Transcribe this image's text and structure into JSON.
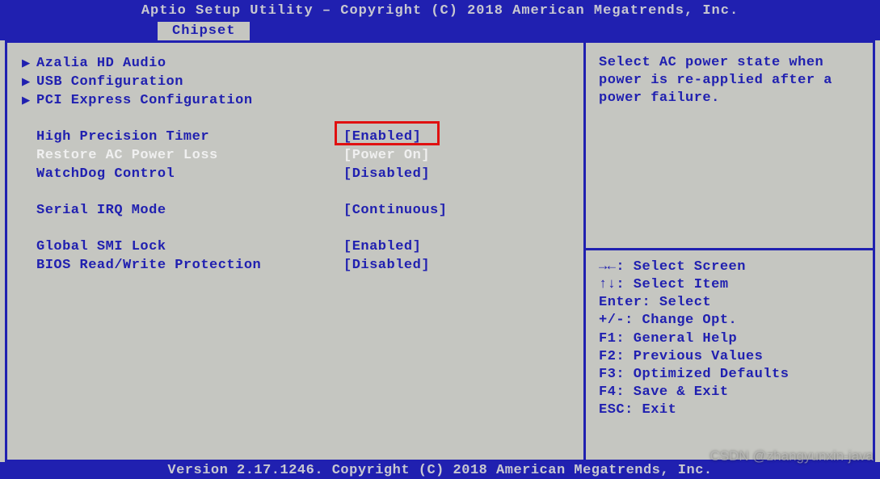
{
  "title": "Aptio Setup Utility – Copyright (C) 2018 American Megatrends, Inc.",
  "tab": "Chipset",
  "submenus": [
    "Azalia HD Audio",
    "USB Configuration",
    "PCI Express Configuration"
  ],
  "settings": {
    "group1": [
      {
        "label": "High Precision Timer",
        "value": "[Enabled]",
        "selected": false
      },
      {
        "label": "Restore AC Power Loss",
        "value": "[Power On]",
        "selected": true,
        "highlighted": true
      },
      {
        "label": "WatchDog Control",
        "value": "[Disabled]",
        "selected": false
      }
    ],
    "group2": [
      {
        "label": "Serial IRQ Mode",
        "value": "[Continuous]",
        "selected": false
      }
    ],
    "group3": [
      {
        "label": "Global SMI Lock",
        "value": "[Enabled]",
        "selected": false
      },
      {
        "label": "BIOS Read/Write Protection",
        "value": "[Disabled]",
        "selected": false
      }
    ]
  },
  "help_text": "Select AC power state when power is re-applied after a power failure.",
  "key_help": [
    "→←: Select Screen",
    "↑↓: Select Item",
    "Enter: Select",
    "+/-: Change Opt.",
    "F1: General Help",
    "F2: Previous Values",
    "F3: Optimized Defaults",
    "F4: Save & Exit",
    "ESC: Exit"
  ],
  "footer": "Version 2.17.1246. Copyright (C) 2018 American Megatrends, Inc.",
  "watermark": "CSDN @zhangyunxin-java"
}
